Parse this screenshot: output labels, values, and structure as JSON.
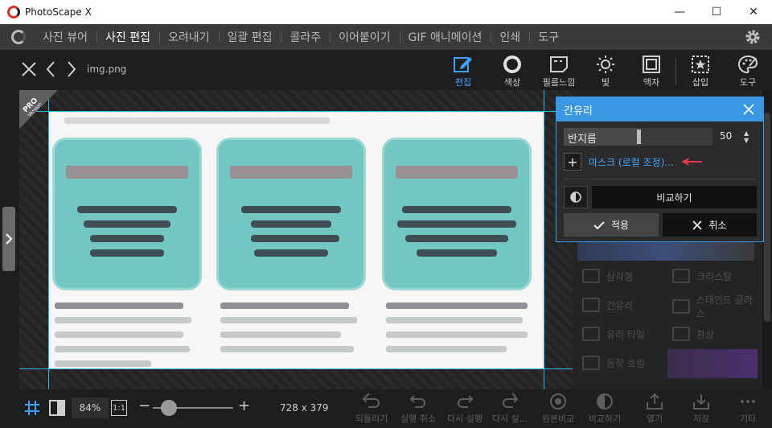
{
  "window": {
    "title": "PhotoScape X",
    "minimize": "—",
    "maximize": "☐",
    "close": "✕"
  },
  "menu": [
    {
      "label": "사진 뷰어",
      "active": false
    },
    {
      "label": "사진 편집",
      "active": true
    },
    {
      "label": "오려내기",
      "active": false
    },
    {
      "label": "일괄 편집",
      "active": false
    },
    {
      "label": "콜라주",
      "active": false
    },
    {
      "label": "이어붙이기",
      "active": false
    },
    {
      "label": "GIF 애니메이션",
      "active": false
    },
    {
      "label": "인쇄",
      "active": false
    },
    {
      "label": "도구",
      "active": false
    }
  ],
  "toolbar": {
    "filename": "img.png",
    "tools": [
      {
        "label": "편집",
        "icon": "pencil-square-icon",
        "active": true
      },
      {
        "label": "색상",
        "icon": "circle-icon",
        "active": false
      },
      {
        "label": "필름느낌",
        "icon": "film-card-icon",
        "active": false
      },
      {
        "label": "빛",
        "icon": "sun-icon",
        "active": false
      },
      {
        "label": "액자",
        "icon": "frame-icon",
        "active": false
      },
      {
        "label": "삽입",
        "icon": "star-box-icon",
        "active": false
      },
      {
        "label": "도구",
        "icon": "palette-icon",
        "active": false
      }
    ]
  },
  "badge": {
    "line1": "PRO",
    "line2": "Version"
  },
  "effects": [
    {
      "label": "삼각형",
      "col": 0,
      "row": 0
    },
    {
      "label": "크리스탈",
      "col": 1,
      "row": 0
    },
    {
      "label": "간유리",
      "col": 0,
      "row": 1
    },
    {
      "label": "스테인드 글라스",
      "col": 1,
      "row": 1
    },
    {
      "label": "유리 타일",
      "col": 0,
      "row": 2
    },
    {
      "label": "환상",
      "col": 1,
      "row": 2
    },
    {
      "label": "동작 흐림",
      "col": 0,
      "row": 3
    }
  ],
  "dialog": {
    "title": "간유리",
    "slider_label": "반지름",
    "slider_value": 50,
    "slider_max": 100,
    "mask_link": "마스크 (로컬 조정)...",
    "compare_label": "비교하기",
    "apply_label": "적용",
    "cancel_label": "취소"
  },
  "bottombar": {
    "zoom": "84%",
    "one_to_one": "1:1",
    "zoom_level": 0.2,
    "dimensions": "728 x 379",
    "tools": [
      {
        "label": "되돌리기",
        "enabled": false
      },
      {
        "label": "실행 취소",
        "enabled": false
      },
      {
        "label": "다시 실행",
        "enabled": false
      },
      {
        "label": "다시 실...",
        "enabled": false
      },
      {
        "label": "원본비교",
        "enabled": false
      },
      {
        "label": "비교하기",
        "enabled": false
      },
      {
        "label": "열기",
        "enabled": false
      },
      {
        "label": "저장",
        "enabled": false
      },
      {
        "label": "기타",
        "enabled": false
      }
    ]
  },
  "colors": {
    "accent": "#3a98e6",
    "link": "#3ea8ff",
    "arrow": "#e8354a"
  }
}
